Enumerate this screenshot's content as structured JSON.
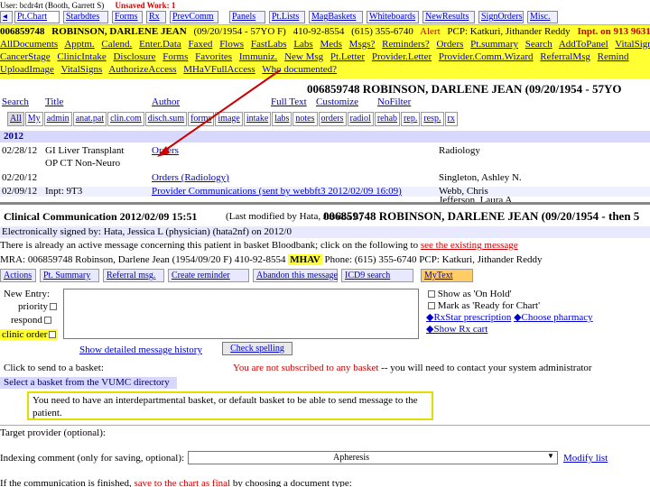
{
  "topline": {
    "user": "User: bcdr4rt (Booth, Garrett S)",
    "unsaved": "Unsaved Work: 1"
  },
  "toptabs": [
    "Pt.Chart",
    "Starbdtes",
    "Forms",
    "Rx",
    "PrevComm",
    "Panels",
    "Pt.Lists",
    "MagBaskets",
    "Whiteboards",
    "NewResults",
    "SignOrders",
    "Misc."
  ],
  "banner": {
    "line1": [
      "006859748",
      "ROBINSON, DARLENE JEAN",
      "(09/20/1954 - 57YO F)",
      "410-92-8554",
      "(615) 355-6740",
      "Alert",
      "PCP: Katkuri, Jithander Reddy",
      "Inpt. on 913 9631"
    ],
    "line2": [
      "AllDocuments",
      "Apptm.",
      "Calend.",
      "Enter.Data",
      "Faxed",
      "Flows",
      "FastLabs",
      "Labs",
      "Meds",
      "Msgs?",
      "Reminders?",
      "Orders",
      "Pt.summary",
      "Search",
      "AddToPanel",
      "VitalSigns"
    ],
    "line3": [
      "CancerStage",
      "ClinicIntake",
      "Disclosure",
      "Forms",
      "Favorites",
      "Immuniz.",
      "New Msg",
      "Pt.Letter",
      "Provider.Letter",
      "Provider.Comm.Wizard",
      "ReferralMsg",
      "Remind"
    ],
    "line4": [
      "UploadImage",
      "VitalSigns",
      "AuthorizeAccess",
      "MHaVFullAccess",
      "Who documented?"
    ]
  },
  "doclist": {
    "patient_header": "006859748   ROBINSON, DARLENE JEAN   (09/20/1954 - 57YO",
    "search_row": [
      "Search",
      "Title",
      "Author",
      "Full Text",
      "Customize",
      "NoFilter"
    ],
    "filters": [
      "All",
      "My",
      "admin",
      "anat.pat",
      "clin.com",
      "disch.sum",
      "forms",
      "image",
      "intake",
      "labs",
      "notes",
      "orders",
      "radiol",
      "rehab",
      "rep.",
      "resp.",
      "rx"
    ],
    "year": "2012",
    "rows": [
      {
        "date": "02/28/12",
        "type": "GI Liver Transplant",
        "note": "Orders",
        "author": "Radiology"
      },
      {
        "date": "",
        "type": "OP CT Non-Neuro",
        "note": "",
        "author": ""
      },
      {
        "date": "02/20/12",
        "type": "",
        "note": "Orders (Radiology)",
        "author": "Singleton, Ashley N."
      },
      {
        "date": "02/09/12",
        "type": "Inpt: 9T3",
        "note": "Provider Communications (sent by webbft3 2012/02/09 16:09)",
        "author": "Webb, Chris"
      }
    ],
    "continuation": "Jefferson, Laura A"
  },
  "clinical_comm": {
    "title": "Clinical Communication 2012/02/09 15:51",
    "modified": "(Last modified by Hata, Jessica L)",
    "patient": "006859748   ROBINSON, DARLENE JEAN   (09/20/1954 - then 5",
    "signed": "Electronically signed by: Hata, Jessica L (physician) (hata2nf) on 2012/0",
    "active_msg": "There is already an active message concerning this patient in basket Bloodbank; click on the following to",
    "see_existing": "see the existing message",
    "mra": "MRA: 006859748   Robinson, Darlene Jean   (1954/09/20 F) 410-92-8554",
    "mhav": "MHAV",
    "mra_tail": "Phone: (615) 355-6740   PCP: Katkuri, Jithander Reddy",
    "actions": [
      "Actions",
      "Pt. Summary",
      "Referral msg.",
      "Create reminder",
      "Abandon this message",
      "ICD9 search",
      "MyText"
    ],
    "new_entry_label": "New Entry:",
    "flags": [
      "priority",
      "respond",
      "clinic order"
    ],
    "right_options": [
      "Show as 'On Hold'",
      "Mark as 'Ready for Chart'",
      "RxStar prescription",
      "Choose pharmacy",
      "Show Rx cart"
    ],
    "history_link": "Show detailed message history",
    "spell_check": "Check spelling",
    "send_label": "Click to send to a basket:",
    "not_subscribed": "You are not subscribed to any basket",
    "not_subscribed_tail": "-- you will need to contact your system administrator",
    "vumc": "Select a basket from the VUMC directory",
    "warning": "You need to have an interdepartmental basket, or default basket to be able to send message to the patient.",
    "target_provider": "Target provider (optional):",
    "indexing_label": "Indexing comment (only for saving, optional):",
    "indexing_value": "Apheresis",
    "modify_list": "Modify list",
    "bottom_text": "If the communication is finished,",
    "bottom_red": "save to the chart as final",
    "bottom_tail": "by choosing a document type:"
  },
  "colors": {
    "banner": "#ffff33",
    "link": "#0000cc",
    "alert_red": "#cc0000",
    "arrow": "#cc0000",
    "panel_blue": "#d8d8ff"
  }
}
